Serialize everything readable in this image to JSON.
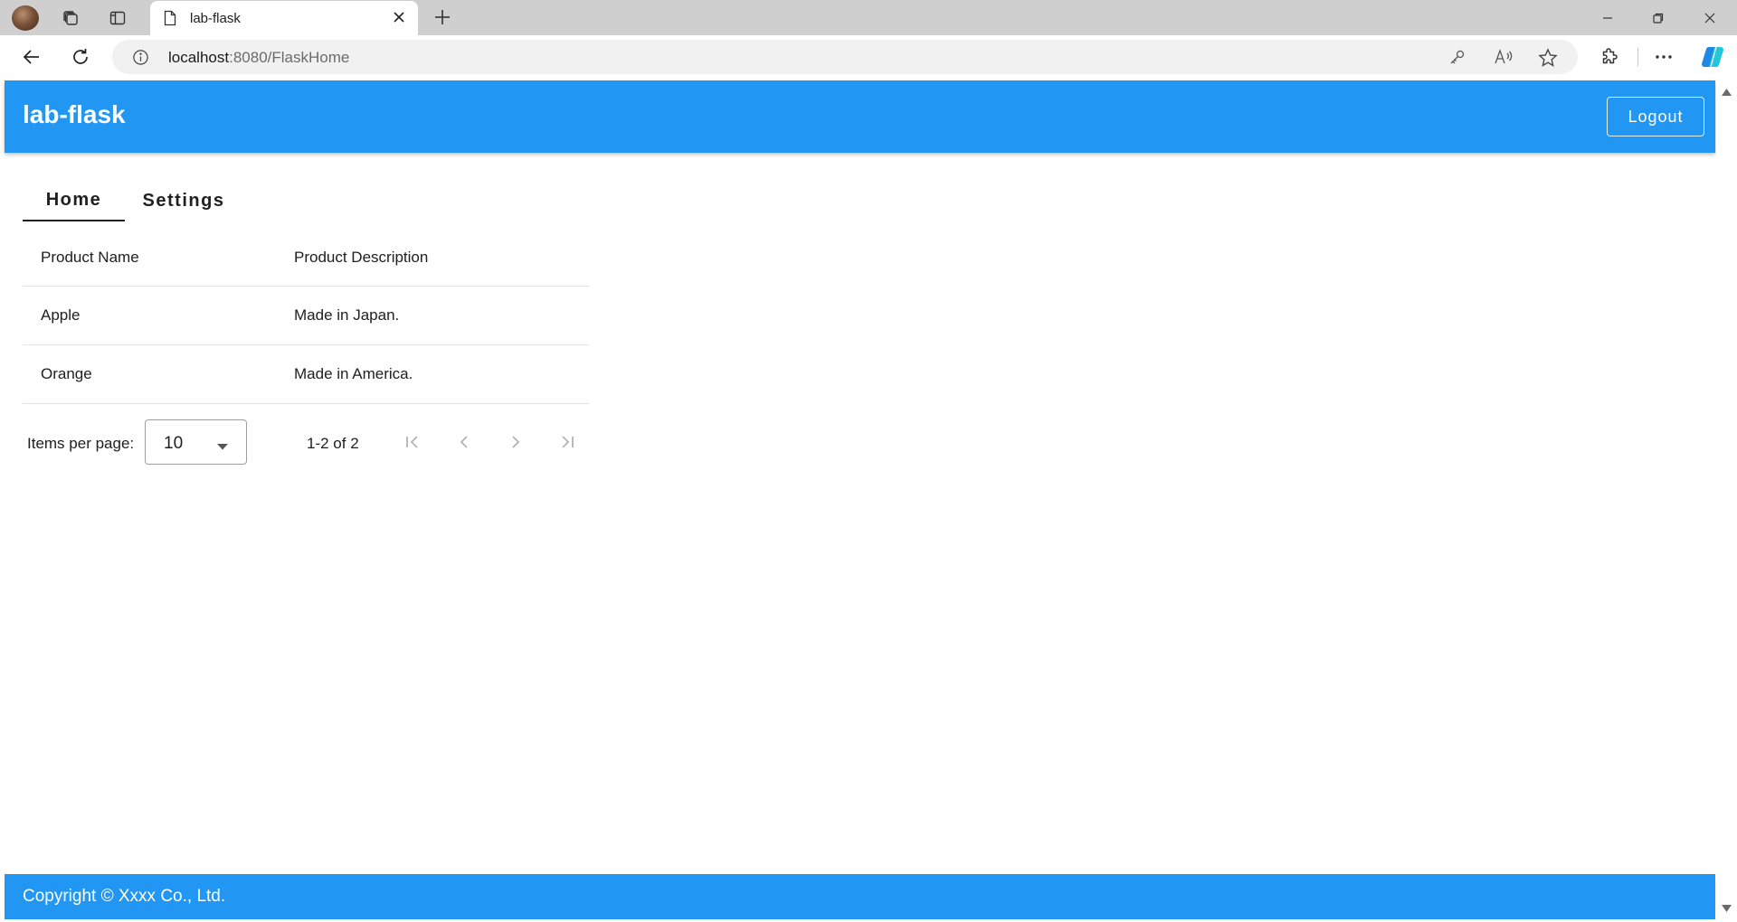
{
  "browser": {
    "tab_title": "lab-flask",
    "url_host": "localhost",
    "url_rest": ":8080/FlaskHome"
  },
  "app": {
    "title": "lab-flask",
    "logout_label": "Logout",
    "brand_color": "#2196f3"
  },
  "nav": {
    "tabs": [
      {
        "label": "Home",
        "active": true
      },
      {
        "label": "Settings",
        "active": false
      }
    ]
  },
  "table": {
    "headers": [
      "Product Name",
      "Product Description"
    ],
    "rows": [
      [
        "Apple",
        "Made in Japan."
      ],
      [
        "Orange",
        "Made in America."
      ]
    ]
  },
  "pagination": {
    "items_per_page_label": "Items per page:",
    "items_per_page_value": "10",
    "range_label": "1-2 of 2"
  },
  "footer": {
    "copyright": "Copyright © Xxxx Co., Ltd."
  }
}
